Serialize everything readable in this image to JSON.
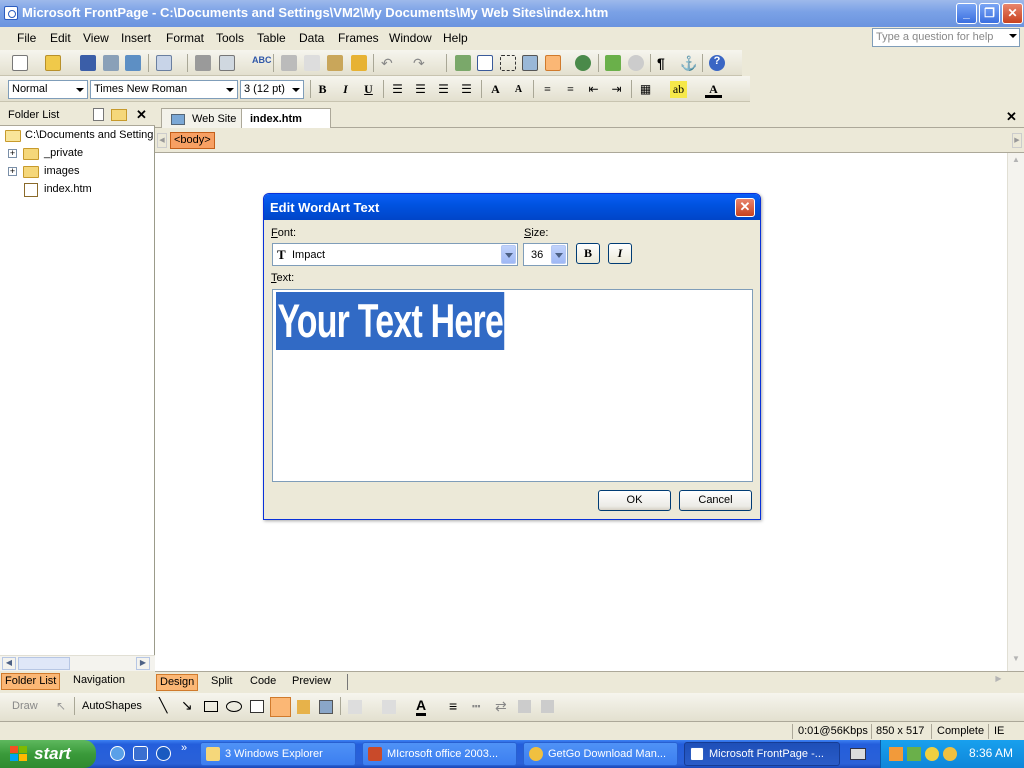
{
  "window": {
    "title": "Microsoft FrontPage - C:\\Documents and Settings\\VM2\\My Documents\\My Web Sites\\index.htm"
  },
  "menu": {
    "items": [
      "File",
      "Edit",
      "View",
      "Insert",
      "Format",
      "Tools",
      "Table",
      "Data",
      "Frames",
      "Window",
      "Help"
    ],
    "ask_placeholder": "Type a question for help"
  },
  "formatting": {
    "style": "Normal",
    "font": "Times New Roman",
    "size": "3  (12 pt)",
    "bold": "B",
    "italic": "I",
    "underline": "U"
  },
  "folder_list": {
    "title": "Folder List",
    "root": "C:\\Documents and Setting",
    "items": [
      "_private",
      "images",
      "index.htm"
    ]
  },
  "left_tabs": {
    "folder_list": "Folder List",
    "navigation": "Navigation"
  },
  "doc_tabs": {
    "web_site": "Web Site",
    "index": "index.htm"
  },
  "tag_selector": "<body>",
  "view_tabs": {
    "design": "Design",
    "split": "Split",
    "code": "Code",
    "preview": "Preview"
  },
  "drawing": {
    "draw": "Draw",
    "autoshapes": "AutoShapes"
  },
  "status": {
    "speed": "0:01@56Kbps",
    "dimensions": "850 x 517",
    "state": "Complete",
    "browser": "IE"
  },
  "dialog": {
    "title": "Edit WordArt Text",
    "font_label": "Font:",
    "font_value": "Impact",
    "size_label": "Size:",
    "size_value": "36",
    "bold": "B",
    "italic": "I",
    "text_label": "Text:",
    "text_value": "Your Text Here",
    "ok": "OK",
    "cancel": "Cancel"
  },
  "taskbar": {
    "start": "start",
    "tasks": [
      "3 Windows Explorer",
      "MIcrosoft office 2003...",
      "GetGo Download Man...",
      "Microsoft FrontPage -..."
    ],
    "clock": "8:36 AM"
  },
  "colors": {
    "xp_blue": "#0053e1",
    "selection": "#316ac5",
    "tag_orange": "#f7a063",
    "start_green": "#3a9a3a"
  }
}
